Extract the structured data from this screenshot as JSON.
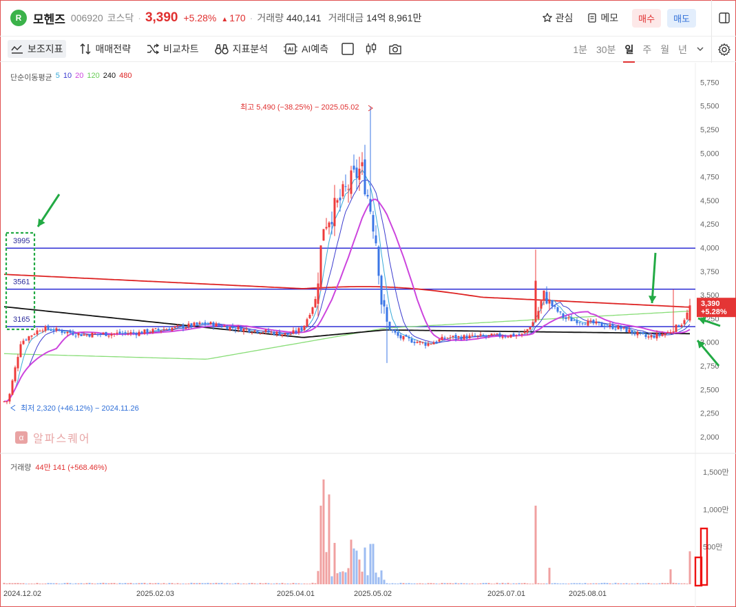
{
  "header": {
    "logo_text": "R",
    "name": "모헨즈",
    "code": "006920",
    "market": "코스닥",
    "price": "3,390",
    "change_pct": "+5.28%",
    "change_amt": "170",
    "volume_label": "거래량",
    "volume_value": "440,141",
    "amount_label": "거래대금",
    "amount_value": "14억 8,961만",
    "watch_label": "관심",
    "memo_label": "메모",
    "buy_label": "매수",
    "sell_label": "매도"
  },
  "toolbar": {
    "indicators_label": "보조지표",
    "strategy_label": "매매전략",
    "compare_label": "비교차트",
    "analysis_label": "지표분석",
    "ai_label": "AI예측",
    "periods": [
      "1분",
      "30분",
      "일",
      "주",
      "월",
      "년"
    ],
    "selected_period": "일"
  },
  "chart_data": {
    "type": "candlestick",
    "moving_average": {
      "label": "단순이동평균",
      "periods": [
        {
          "name": "5",
          "color": "#36a9d8"
        },
        {
          "name": "10",
          "color": "#3a3acf"
        },
        {
          "name": "20",
          "color": "#cc44dd"
        },
        {
          "name": "120",
          "color": "#77dd66"
        },
        {
          "name": "240",
          "color": "#111111"
        },
        {
          "name": "480",
          "color": "#dd2222"
        }
      ]
    },
    "y_ticks": [
      "5,750",
      "5,500",
      "5,250",
      "5,000",
      "4,750",
      "4,500",
      "4,250",
      "4,000",
      "3,750",
      "3,500",
      "3,250",
      "3,000",
      "2,750",
      "2,500",
      "2,250",
      "2,000"
    ],
    "ylim": [
      2000,
      5750
    ],
    "x_ticks": [
      "2024.12.02",
      "2025.02.03",
      "2025.04.01",
      "2025.05.02",
      "2025.07.01",
      "2025.08.01"
    ],
    "high_annotation": "최고 5,490 (−38.25%) − 2025.05.02",
    "low_annotation": "최저 2,320 (+46.12%) − 2024.11.26",
    "current_price": "3,390",
    "current_pct": "+5.28%",
    "horizontal_lines": [
      {
        "label": "3995",
        "value": 3995,
        "color": "#1a1ad0"
      },
      {
        "label": "3561",
        "value": 3561,
        "color": "#1a1ad0"
      },
      {
        "label": "3165",
        "value": 3165,
        "color": "#1a1ad0"
      }
    ],
    "volume": {
      "label": "거래량",
      "value": "44만 141 (+568.46%)",
      "ticks": [
        "1,500만",
        "1,000만",
        "500만"
      ],
      "ylim": [
        0,
        1500
      ]
    },
    "watermark": "알파스퀘어"
  },
  "colors": {
    "up": "#ee3b3b",
    "down": "#3a76e6",
    "annotation_green": "#22aa44",
    "highlight_red": "#ee1111"
  }
}
